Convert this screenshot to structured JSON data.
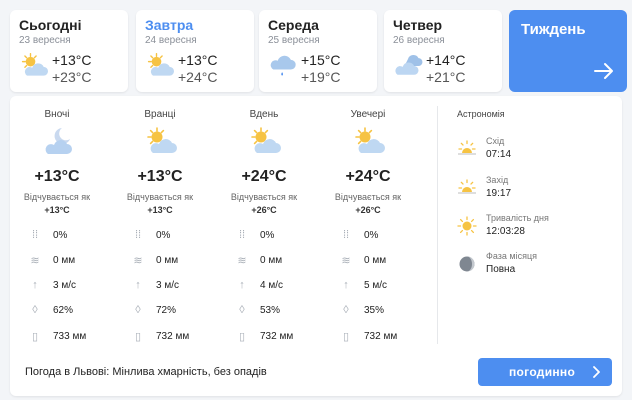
{
  "days": [
    {
      "name": "Сьогодні",
      "date": "23 вересня",
      "icon": "partly-cloudy-icon",
      "max": "+13°C",
      "min": "+23°C"
    },
    {
      "name": "Завтра",
      "date": "24 вересня",
      "icon": "partly-cloudy-icon",
      "max": "+13°C",
      "min": "+24°C"
    },
    {
      "name": "Середа",
      "date": "25 вересня",
      "icon": "light-rain-icon",
      "max": "+15°C",
      "min": "+19°C"
    },
    {
      "name": "Четвер",
      "date": "26 вересня",
      "icon": "cloudy-icon",
      "max": "+14°C",
      "min": "+21°C"
    }
  ],
  "week_button": {
    "label": "Тиждень",
    "icon": "arrow-right-icon"
  },
  "periods": [
    {
      "label": "Вночі",
      "icon": "moon-cloud-icon",
      "temp": "+13°C",
      "feels_label": "Відчувається як",
      "feels": "+13°C",
      "precip_prob": "0%",
      "precip": "0 мм",
      "wind": "3 м/с",
      "humidity": "62%",
      "pressure": "733 мм"
    },
    {
      "label": "Вранці",
      "icon": "partly-cloudy-icon",
      "temp": "+13°C",
      "feels_label": "Відчувається як",
      "feels": "+13°C",
      "precip_prob": "0%",
      "precip": "0 мм",
      "wind": "3 м/с",
      "humidity": "72%",
      "pressure": "732 мм"
    },
    {
      "label": "Вдень",
      "icon": "partly-cloudy-icon",
      "temp": "+24°C",
      "feels_label": "Відчувається як",
      "feels": "+26°C",
      "precip_prob": "0%",
      "precip": "0 мм",
      "wind": "4 м/с",
      "humidity": "53%",
      "pressure": "732 мм"
    },
    {
      "label": "Увечері",
      "icon": "partly-cloudy-icon",
      "temp": "+24°C",
      "feels_label": "Відчувається як",
      "feels": "+26°C",
      "precip_prob": "0%",
      "precip": "0 мм",
      "wind": "5 м/с",
      "humidity": "35%",
      "pressure": "732 мм"
    }
  ],
  "astronomy": {
    "title": "Астрономія",
    "items": [
      {
        "label": "Схід",
        "value": "07:14",
        "icon": "sunrise-icon"
      },
      {
        "label": "Захід",
        "value": "19:17",
        "icon": "sunset-icon"
      },
      {
        "label": "Тривалість дня",
        "value": "12:03:28",
        "icon": "sun-icon"
      },
      {
        "label": "Фаза місяця",
        "value": "Повна",
        "icon": "moon-phase-icon"
      }
    ]
  },
  "summary": "Погода в Львові: Мінлива хмарність, без опадів",
  "hourly_button": {
    "label": "погодинно"
  },
  "colors": {
    "accent": "#4d8ef0",
    "sun": "#f6c343",
    "cloud": "#b9d5f3"
  }
}
